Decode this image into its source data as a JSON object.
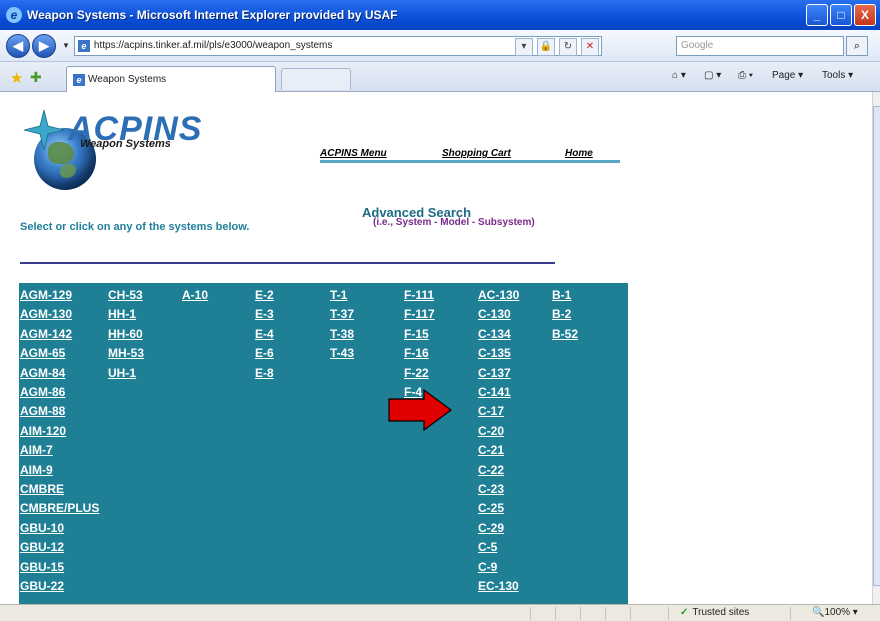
{
  "window": {
    "title": "Weapon Systems - Microsoft Internet Explorer provided by USAF",
    "min_label": "_",
    "max_label": "□",
    "close_label": "X"
  },
  "addressbar": {
    "url": "https://acpins.tinker.af.mil/pls/e3000/weapon_systems",
    "search_placeholder": "Google"
  },
  "tabbar": {
    "tab_label": "Weapon Systems",
    "home_label": "⌂ ▾",
    "feeds_label": "▢ ▾",
    "print_label": "⎙ ▾",
    "page_label": "Page ▾",
    "tools_label": "Tools ▾"
  },
  "page": {
    "logo_text": "ACPINS",
    "logo_sub": "Weapon Systems",
    "nav": {
      "menu": "ACPINS Menu",
      "cart": "Shopping Cart",
      "home": "Home"
    },
    "adv_title": "Advanced Search",
    "adv_sub": "(i.e., System - Model - Subsystem)",
    "instruction": "Select or click on any of the systems below.",
    "columns": [
      [
        "AGM-129",
        "AGM-130",
        "AGM-142",
        "AGM-65",
        "AGM-84",
        "AGM-86",
        "AGM-88",
        "AIM-120",
        "AIM-7",
        "AIM-9",
        "CMBRE",
        "CMBRE/PLUS",
        "GBU-10",
        "GBU-12",
        "GBU-15",
        "GBU-22"
      ],
      [
        "CH-53",
        "HH-1",
        "HH-60",
        "MH-53",
        "UH-1"
      ],
      [
        "A-10"
      ],
      [
        "E-2",
        "E-3",
        "E-4",
        "E-6",
        "E-8"
      ],
      [
        "T-1",
        "T-37",
        "T-38",
        "T-43"
      ],
      [
        "F-111",
        "F-117",
        "F-15",
        "F-16",
        "F-22",
        "F-4"
      ],
      [
        "AC-130",
        "C-130",
        "C-134",
        "C-135",
        "C-137",
        "C-141",
        "C-17",
        "C-20",
        "C-21",
        "C-22",
        "C-23",
        "C-25",
        "C-29",
        "C-5",
        "C-9",
        "EC-130"
      ],
      [
        "B-1",
        "B-2",
        "B-52"
      ]
    ]
  },
  "status": {
    "zone": "Trusted sites",
    "zoom": "100%"
  },
  "colors": {
    "table_bg": "#1f7f95",
    "arrow": "#e00000",
    "heading": "#1e6b83"
  }
}
